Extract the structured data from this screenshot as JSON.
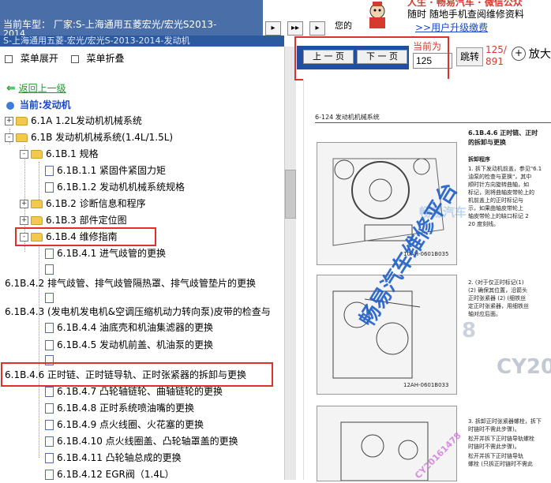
{
  "header": {
    "vehicle_label": "当前车型：  厂家:S-上海通用五菱宏光/宏光S2013-",
    "vehicle_model_suffix": "2014",
    "divider_text": "S-上海通用五菱-宏光/宏光S-2013-2014-发动机",
    "promo_line1": "随时 随地手机查阅维修资料",
    "promo_link": ">>用户升级缴费",
    "promo_partial": "您的"
  },
  "menu": {
    "expand_label": "菜单展开",
    "collapse_label": "菜单折叠",
    "back_label": "返回上一级",
    "current_label": "当前:发动机"
  },
  "tree": [
    {
      "label": "6.1A 1.2L发动机机械系统",
      "type": "folder",
      "expander": "+"
    },
    {
      "label": "6.1B 发动机机械系统(1.4L/1.5L)",
      "type": "folder",
      "expander": "-"
    },
    {
      "label": "6.1B.1 规格",
      "type": "folder",
      "expander": "-"
    },
    {
      "label": "6.1B.1.1 紧固件紧固力矩",
      "type": "doc"
    },
    {
      "label": "6.1B.1.2 发动机机械系统规格",
      "type": "doc"
    },
    {
      "label": "6.1B.2 诊断信息和程序",
      "type": "folder",
      "expander": "+"
    },
    {
      "label": "6.1B.3 部件定位图",
      "type": "folder",
      "expander": "+"
    },
    {
      "label": "6.1B.4 维修指南",
      "type": "folder",
      "expander": "-"
    },
    {
      "label": "6.1B.4.1 进气歧管的更换",
      "type": "doc"
    },
    {
      "label": "6.1B.4.2 排气歧管、排气歧管隔热罩、排气歧管垫片的更换",
      "type": "doc"
    },
    {
      "label": "6.1B.4.3 (发电机发电机&空调压缩机动力转向泵)皮带的检查与",
      "type": "doc"
    },
    {
      "label": "6.1B.4.4 油底壳和机油集滤器的更换",
      "type": "doc"
    },
    {
      "label": "6.1B.4.5 发动机前盖、机油泵的更换",
      "type": "doc"
    },
    {
      "label": "6.1B.4.6 正时链、正时链导轨、正时张紧器的拆卸与更换",
      "type": "doc"
    },
    {
      "label": "6.1B.4.7 凸轮轴链轮、曲轴链轮的更换",
      "type": "doc"
    },
    {
      "label": "6.1B.4.8 正时系统喷油嘴的更换",
      "type": "doc"
    },
    {
      "label": "6.1B.4.9 点火线圈、火花塞的更换",
      "type": "doc"
    },
    {
      "label": "6.1B.4.10 点火线圈盖、凸轮轴罩盖的更换",
      "type": "doc"
    },
    {
      "label": "6.1B.4.11 凸轮轴总成的更换",
      "type": "doc"
    },
    {
      "label": "6.1B.4.12 EGR阀（1.4L）",
      "type": "doc"
    }
  ],
  "viewer": {
    "prev_label": "上 一 页",
    "next_label": "下 一 页",
    "current_page_label": "当前为",
    "page_value": "125",
    "page_total_top": "125/",
    "page_total_bottom": "891",
    "goto_label": "跳转",
    "zoom_label": "放大"
  },
  "document": {
    "page_header": "6-124 发动机机械系统",
    "section_title_1": "6.1B.4.6    正时链、正时",
    "section_title_2": "的拆卸与更换",
    "proc_title": "拆卸程序",
    "steps": [
      "1.  拆下发动机前盖，参见\"6.1",
      "    油泵的检查与更换\"，其中",
      "    顺时针方向旋转曲轴，如",
      "    标记，则将曲轴皮带轮上的",
      "    机前盖上的正时标记与",
      "    示，如果曲轴皮带轮上",
      "    轴皮带轮上的缺口标记 2",
      "    20 度刻线。"
    ],
    "fig1_label": "10AH-0601B035",
    "fig2_label": "12AH-0601B033",
    "steps2": [
      "2.  (对于仅正时标记(1)",
      "    (2) 确保其位置，沿箭头",
      "    正时张紧器 (2) (细铁丝",
      "    定正时张紧器，用细铁丝",
      "    轴对应后面。"
    ],
    "steps3": [
      "3.  拆卸正时张紧器螺栓，拆下",
      "    时链时不需此步骤)。",
      "    松开并拆下正时链导轨螺栓",
      "    时链时不需此步骤)。",
      "    松开并拆下正时链导轨",
      "    螺栓 (只拆正时链时不需此"
    ],
    "watermark_1": "畅易汽车",
    "watermark_2": "畅易汽车维修平台",
    "watermark_3": "CY201",
    "watermark_4": "8",
    "watermark_5": "CY20161478"
  }
}
